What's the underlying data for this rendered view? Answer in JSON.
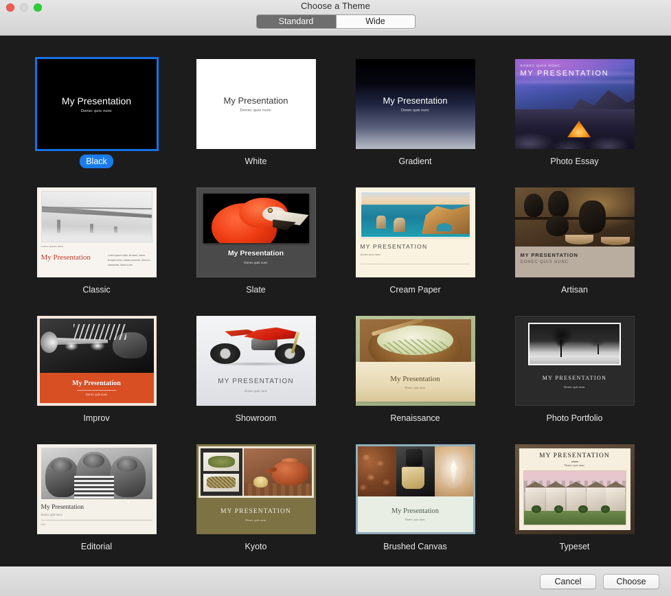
{
  "window": {
    "title": "Choose a Theme",
    "traffic_lights": [
      "close-button",
      "minimize-button",
      "zoom-button"
    ]
  },
  "segmented_control": {
    "options": [
      {
        "label": "Standard",
        "selected": true
      },
      {
        "label": "Wide",
        "selected": false
      }
    ]
  },
  "selection": {
    "selected_theme": "Black",
    "accent_color": "#1a7ceb",
    "border_color": "#1673e6"
  },
  "slide_text": {
    "title_mixed": "My Presentation",
    "title_caps": "MY PRESENTATION",
    "subtitle_mixed": "Donec quis nunc",
    "subtitle_caps": "DONEC QUIS NUNC",
    "classic_caption": "Lorem ipsum dolor",
    "classic_body": "Lorem ipsum dolor sit amet, lorem tempus lorem nullam posuere, libero in maecenas. Morbi a leo.",
    "editorial_footer": "Nibh"
  },
  "themes": [
    {
      "id": "black",
      "label": "Black",
      "selected": true
    },
    {
      "id": "white",
      "label": "White",
      "selected": false
    },
    {
      "id": "gradient",
      "label": "Gradient",
      "selected": false
    },
    {
      "id": "photo-essay",
      "label": "Photo Essay",
      "selected": false
    },
    {
      "id": "classic",
      "label": "Classic",
      "selected": false
    },
    {
      "id": "slate",
      "label": "Slate",
      "selected": false
    },
    {
      "id": "cream-paper",
      "label": "Cream Paper",
      "selected": false
    },
    {
      "id": "artisan",
      "label": "Artisan",
      "selected": false
    },
    {
      "id": "improv",
      "label": "Improv",
      "selected": false
    },
    {
      "id": "showroom",
      "label": "Showroom",
      "selected": false
    },
    {
      "id": "renaissance",
      "label": "Renaissance",
      "selected": false
    },
    {
      "id": "photo-portfolio",
      "label": "Photo Portfolio",
      "selected": false
    },
    {
      "id": "editorial",
      "label": "Editorial",
      "selected": false
    },
    {
      "id": "kyoto",
      "label": "Kyoto",
      "selected": false
    },
    {
      "id": "brushed-canvas",
      "label": "Brushed Canvas",
      "selected": false
    },
    {
      "id": "typeset",
      "label": "Typeset",
      "selected": false
    }
  ],
  "footer": {
    "cancel_label": "Cancel",
    "choose_label": "Choose"
  }
}
